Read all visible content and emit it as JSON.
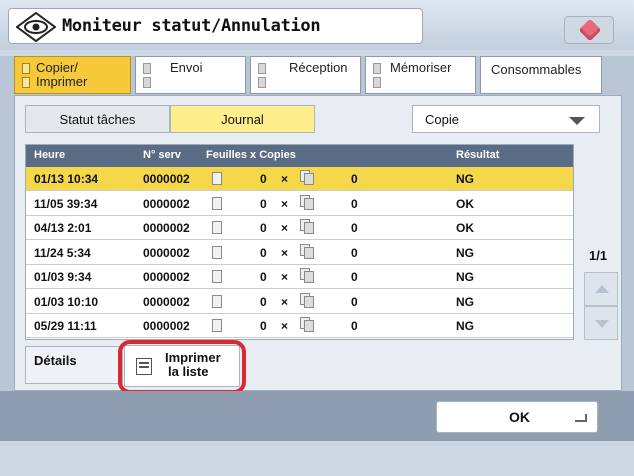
{
  "header": {
    "title": "Moniteur statut/Annulation"
  },
  "tabs": [
    {
      "line1": "Copier/",
      "line2": "Imprimer",
      "active": true
    },
    {
      "line1": "Envoi",
      "line2": "",
      "active": false
    },
    {
      "line1": "Réception",
      "line2": "",
      "active": false
    },
    {
      "line1": "Mémoriser",
      "line2": "",
      "active": false
    },
    {
      "line1": "Consommables",
      "line2": "",
      "active": false
    }
  ],
  "subtabs": {
    "status": "Statut tâches",
    "journal": "Journal"
  },
  "filter": {
    "selected": "Copie"
  },
  "table": {
    "columns": {
      "time": "Heure",
      "num": "N° serv",
      "sheets_copies": "Feuilles x Copies",
      "result": "Résultat"
    },
    "rows": [
      {
        "time": "01/13 10:34",
        "num": "0000002",
        "sheets": "0",
        "x": "×",
        "copies": "0",
        "result": "NG",
        "selected": true
      },
      {
        "time": "11/05 39:34",
        "num": "0000002",
        "sheets": "0",
        "x": "×",
        "copies": "0",
        "result": "OK",
        "selected": false
      },
      {
        "time": "04/13 2:01",
        "num": "0000002",
        "sheets": "0",
        "x": "×",
        "copies": "0",
        "result": "OK",
        "selected": false
      },
      {
        "time": "11/24 5:34",
        "num": "0000002",
        "sheets": "0",
        "x": "×",
        "copies": "0",
        "result": "NG",
        "selected": false
      },
      {
        "time": "01/03 9:34",
        "num": "0000002",
        "sheets": "0",
        "x": "×",
        "copies": "0",
        "result": "NG",
        "selected": false
      },
      {
        "time": "01/03 10:10",
        "num": "0000002",
        "sheets": "0",
        "x": "×",
        "copies": "0",
        "result": "NG",
        "selected": false
      },
      {
        "time": "05/29 11:11",
        "num": "0000002",
        "sheets": "0",
        "x": "×",
        "copies": "0",
        "result": "NG",
        "selected": false
      }
    ]
  },
  "pager": {
    "label": "1/1"
  },
  "buttons": {
    "details": "Détails",
    "print_line1": "Imprimer",
    "print_line2": "la liste",
    "ok": "OK"
  },
  "colors": {
    "accent_yellow": "#f5c93a",
    "selected_row": "#f5d74a",
    "highlight_red": "#d92a34",
    "header_dark": "#5a6c85"
  }
}
